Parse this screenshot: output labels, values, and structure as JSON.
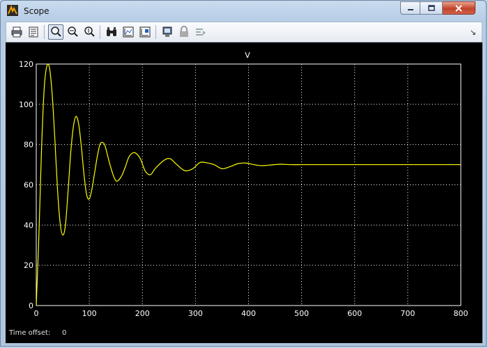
{
  "window": {
    "title": "Scope",
    "buttons": {
      "minimize": "minimize",
      "maximize": "maximize",
      "close": "close"
    }
  },
  "toolbar": {
    "items": [
      {
        "icon": "printer-icon"
      },
      {
        "icon": "parameters-icon"
      },
      {
        "icon": "zoom-icon",
        "active": true
      },
      {
        "icon": "zoom-x-icon"
      },
      {
        "icon": "zoom-y-icon"
      },
      {
        "icon": "binoculars-icon"
      },
      {
        "icon": "save-axes-icon"
      },
      {
        "icon": "restore-axes-icon"
      },
      {
        "icon": "floating-scope-icon"
      },
      {
        "icon": "lock-icon"
      },
      {
        "icon": "signal-selection-icon"
      }
    ],
    "overflow_icon": "chevron-down-icon"
  },
  "status": {
    "label": "Time offset:",
    "value": "0"
  },
  "colors": {
    "plot_bg": "#000000",
    "trace": "#ffff00",
    "axes": "#ffffff",
    "grid": "#ffffff"
  },
  "chart_data": {
    "type": "line",
    "title": "V",
    "xlim": [
      0,
      800
    ],
    "ylim": [
      0,
      120
    ],
    "xticks": [
      0,
      100,
      200,
      300,
      400,
      500,
      600,
      700,
      800
    ],
    "yticks": [
      0,
      20,
      40,
      60,
      80,
      100,
      120
    ],
    "grid": true,
    "series": [
      {
        "x": [
          0,
          5,
          10,
          15,
          20,
          25,
          30,
          35,
          40,
          45,
          50,
          55,
          60,
          65,
          70,
          75,
          80,
          85,
          90,
          95,
          100,
          105,
          110,
          115,
          120,
          125,
          130,
          140,
          150,
          160,
          168,
          175,
          185,
          196,
          205,
          215,
          224,
          240,
          252,
          265,
          280,
          295,
          308,
          320,
          335,
          350,
          365,
          380,
          395,
          410,
          425,
          440,
          460,
          480,
          500,
          550,
          600,
          650,
          700,
          750,
          800
        ],
        "y": [
          0,
          35,
          78,
          108,
          119,
          118,
          105,
          83,
          58,
          41,
          35,
          40,
          57,
          76,
          89,
          94,
          90,
          79,
          65,
          55,
          53,
          58,
          66,
          74,
          80,
          81,
          79,
          69,
          62,
          64,
          69,
          74,
          76,
          73,
          67,
          65,
          68,
          72,
          73,
          70,
          67,
          68,
          71,
          71,
          70,
          68,
          69,
          70.5,
          70.8,
          70,
          69.5,
          69.8,
          70.2,
          70,
          70,
          70,
          70,
          70,
          70,
          70,
          70
        ]
      }
    ]
  }
}
